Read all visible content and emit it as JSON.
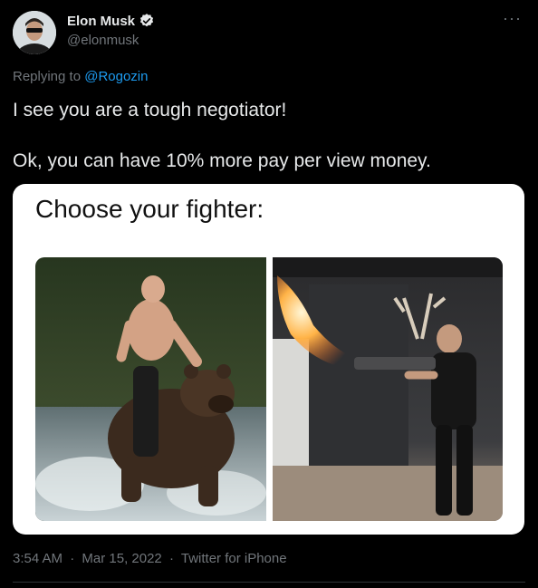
{
  "author": {
    "name": "Elon Musk",
    "handle": "@elonmusk",
    "verified": true
  },
  "reply": {
    "prefix": "Replying to",
    "mention": "@Rogozin"
  },
  "tweet_text": {
    "line1": "I see you are a tough negotiator!",
    "line2": "Ok, you can have 10% more pay per view money."
  },
  "media": {
    "caption": "Choose your fighter:"
  },
  "meta": {
    "time": "3:54 AM",
    "separator": "·",
    "date": "Mar 15, 2022",
    "source": "Twitter for iPhone"
  },
  "colors": {
    "background": "#000000",
    "text": "#e7e9ea",
    "muted": "#71767b",
    "accent": "#1d9bf0"
  },
  "icons": {
    "verified": "verified-badge-icon",
    "more": "more-options-icon"
  }
}
